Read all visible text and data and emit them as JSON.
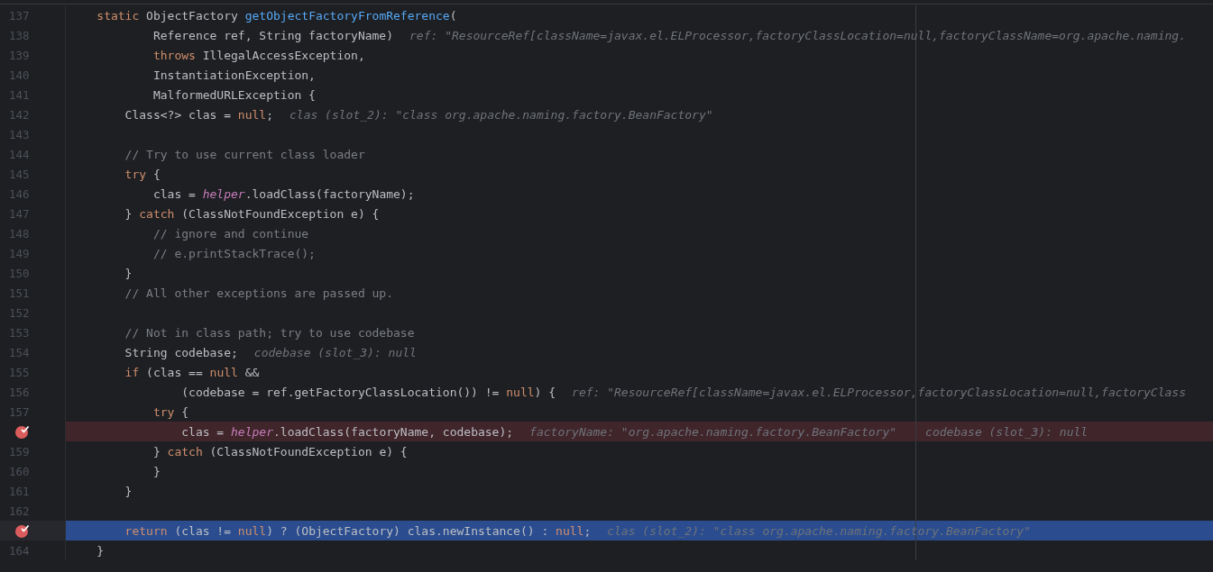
{
  "editor": {
    "lines": [
      {
        "number": "137",
        "kind": "normal",
        "breakpoint": false,
        "tokens": [
          {
            "kind": "keyword",
            "text": "    static"
          },
          {
            "kind": "plain",
            "text": " ObjectFactory "
          },
          {
            "kind": "method",
            "text": "getObjectFactoryFromReference"
          },
          {
            "kind": "plain",
            "text": "("
          }
        ]
      },
      {
        "number": "138",
        "kind": "normal",
        "breakpoint": false,
        "tokens": [
          {
            "kind": "plain",
            "text": "            Reference ref, String factoryName)"
          }
        ],
        "hints": [
          "ref: \"ResourceRef[className=javax.el.ELProcessor,factoryClassLocation=null,factoryClassName=org.apache.naming."
        ]
      },
      {
        "number": "139",
        "kind": "normal",
        "breakpoint": false,
        "tokens": [
          {
            "kind": "keyword",
            "text": "            throws"
          },
          {
            "kind": "plain",
            "text": " IllegalAccessException,"
          }
        ]
      },
      {
        "number": "140",
        "kind": "normal",
        "breakpoint": false,
        "tokens": [
          {
            "kind": "plain",
            "text": "            InstantiationException,"
          }
        ]
      },
      {
        "number": "141",
        "kind": "normal",
        "breakpoint": false,
        "tokens": [
          {
            "kind": "plain",
            "text": "            MalformedURLException {"
          }
        ]
      },
      {
        "number": "142",
        "kind": "normal",
        "breakpoint": false,
        "tokens": [
          {
            "kind": "plain",
            "text": "        Class<?> clas = "
          },
          {
            "kind": "keyword",
            "text": "null"
          },
          {
            "kind": "plain",
            "text": ";"
          }
        ],
        "hints": [
          "clas (slot_2): \"class org.apache.naming.factory.BeanFactory\""
        ]
      },
      {
        "number": "143",
        "kind": "normal",
        "breakpoint": false
      },
      {
        "number": "144",
        "kind": "normal",
        "breakpoint": false,
        "tokens": [
          {
            "kind": "comment",
            "text": "        // Try to use current class loader"
          }
        ]
      },
      {
        "number": "145",
        "kind": "normal",
        "breakpoint": false,
        "tokens": [
          {
            "kind": "keyword",
            "text": "        try"
          },
          {
            "kind": "plain",
            "text": " {"
          }
        ]
      },
      {
        "number": "146",
        "kind": "normal",
        "breakpoint": false,
        "tokens": [
          {
            "kind": "plain",
            "text": "            clas = "
          },
          {
            "kind": "field",
            "text": "helper"
          },
          {
            "kind": "plain",
            "text": ".loadClass(factoryName);"
          }
        ]
      },
      {
        "number": "147",
        "kind": "normal",
        "breakpoint": false,
        "tokens": [
          {
            "kind": "plain",
            "text": "        } "
          },
          {
            "kind": "keyword",
            "text": "catch"
          },
          {
            "kind": "plain",
            "text": " (ClassNotFoundException e) {"
          }
        ]
      },
      {
        "number": "148",
        "kind": "normal",
        "breakpoint": false,
        "tokens": [
          {
            "kind": "comment",
            "text": "            // ignore and continue"
          }
        ]
      },
      {
        "number": "149",
        "kind": "normal",
        "breakpoint": false,
        "tokens": [
          {
            "kind": "comment",
            "text": "            // e.printStackTrace();"
          }
        ]
      },
      {
        "number": "150",
        "kind": "normal",
        "breakpoint": false,
        "tokens": [
          {
            "kind": "plain",
            "text": "        }"
          }
        ]
      },
      {
        "number": "151",
        "kind": "normal",
        "breakpoint": false,
        "tokens": [
          {
            "kind": "comment",
            "text": "        // All other exceptions are passed up."
          }
        ]
      },
      {
        "number": "152",
        "kind": "normal",
        "breakpoint": false
      },
      {
        "number": "153",
        "kind": "normal",
        "breakpoint": false,
        "tokens": [
          {
            "kind": "comment",
            "text": "        // Not in class path; try to use codebase"
          }
        ]
      },
      {
        "number": "154",
        "kind": "normal",
        "breakpoint": false,
        "tokens": [
          {
            "kind": "plain",
            "text": "        String codebase;"
          }
        ],
        "hints": [
          "codebase (slot_3): null"
        ]
      },
      {
        "number": "155",
        "kind": "normal",
        "breakpoint": false,
        "tokens": [
          {
            "kind": "keyword",
            "text": "        if"
          },
          {
            "kind": "plain",
            "text": " (clas == "
          },
          {
            "kind": "keyword",
            "text": "null"
          },
          {
            "kind": "plain",
            "text": " &&"
          }
        ]
      },
      {
        "number": "156",
        "kind": "normal",
        "breakpoint": false,
        "tokens": [
          {
            "kind": "plain",
            "text": "                (codebase = ref.getFactoryClassLocation()) != "
          },
          {
            "kind": "keyword",
            "text": "null"
          },
          {
            "kind": "plain",
            "text": ") {"
          }
        ],
        "hints": [
          "ref: \"ResourceRef[className=javax.el.ELProcessor,factoryClassLocation=null,factoryClass"
        ]
      },
      {
        "number": "157",
        "kind": "normal",
        "breakpoint": false,
        "tokens": [
          {
            "kind": "keyword",
            "text": "            try"
          },
          {
            "kind": "plain",
            "text": " {"
          }
        ]
      },
      {
        "kind": "breakpoint",
        "breakpoint": true,
        "tokens": [
          {
            "kind": "plain",
            "text": "                clas = "
          },
          {
            "kind": "field",
            "text": "helper"
          },
          {
            "kind": "plain",
            "text": ".loadClass(factoryName, codebase);"
          }
        ],
        "hints": [
          "factoryName: \"org.apache.naming.factory.BeanFactory\"",
          "codebase (slot_3): null"
        ]
      },
      {
        "number": "159",
        "kind": "normal",
        "breakpoint": false,
        "tokens": [
          {
            "kind": "plain",
            "text": "            } "
          },
          {
            "kind": "keyword",
            "text": "catch"
          },
          {
            "kind": "plain",
            "text": " (ClassNotFoundException e) {"
          }
        ]
      },
      {
        "number": "160",
        "kind": "normal",
        "breakpoint": false,
        "tokens": [
          {
            "kind": "plain",
            "text": "            }"
          }
        ]
      },
      {
        "number": "161",
        "kind": "normal",
        "breakpoint": false,
        "tokens": [
          {
            "kind": "plain",
            "text": "        }"
          }
        ]
      },
      {
        "number": "162",
        "kind": "normal",
        "breakpoint": false
      },
      {
        "kind": "current",
        "breakpoint": true,
        "tokens": [
          {
            "kind": "keyword",
            "text": "        return"
          },
          {
            "kind": "plain",
            "text": " (clas != "
          },
          {
            "kind": "keyword",
            "text": "null"
          },
          {
            "kind": "plain",
            "text": ") ? (ObjectFactory) clas.newInstance() : "
          },
          {
            "kind": "keyword",
            "text": "null"
          },
          {
            "kind": "plain",
            "text": ";"
          }
        ],
        "hints": [
          "clas (slot_2): \"class org.apache.naming.factory.BeanFactory\""
        ]
      },
      {
        "number": "164",
        "kind": "normal",
        "breakpoint": false,
        "tokens": [
          {
            "kind": "plain",
            "text": "    }"
          }
        ]
      }
    ]
  }
}
